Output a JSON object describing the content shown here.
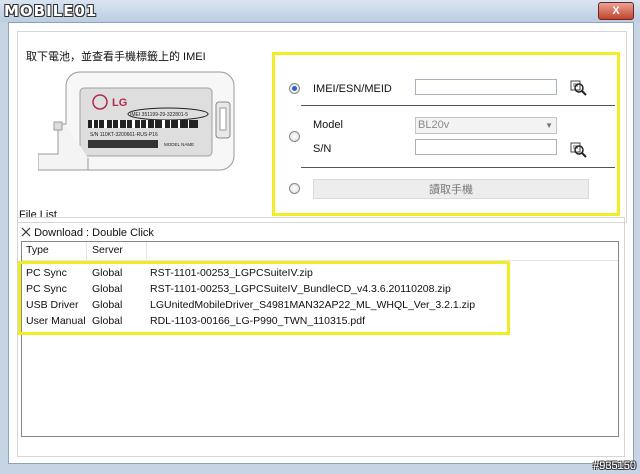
{
  "titlebar": {
    "logo": "MOBILE01",
    "close_label": "X"
  },
  "instructions": "取下電池，並查看手機標籤上的 IMEI",
  "device_label": {
    "brand": "LG",
    "imei_line": "IMEI 351199-29-322801-5",
    "sn_line": "S/N 110KT-3200661-RUS-P16",
    "model_line": "MODEL NAME"
  },
  "options": {
    "imei_label": "IMEI/ESN/MEID",
    "imei_value": "",
    "model_label": "Model",
    "model_value": "BL20v",
    "sn_label": "S/N",
    "sn_value": "",
    "read_phone_label": "讀取手機"
  },
  "file_list": {
    "label": "File List",
    "download_hint": "Download : Double Click",
    "columns": [
      "Type",
      "Server"
    ],
    "rows": [
      {
        "type": "PC Sync",
        "server": "Global",
        "file": "RST-1101-00253_LGPCSuiteIV.zip"
      },
      {
        "type": "PC Sync",
        "server": "Global",
        "file": "RST-1101-00253_LGPCSuiteIV_BundleCD_v4.3.6.20110208.zip"
      },
      {
        "type": "USB Driver",
        "server": "Global",
        "file": "LGUnitedMobileDriver_S4981MAN32AP22_ML_WHQL_Ver_3.2.1.zip"
      },
      {
        "type": "User Manual",
        "server": "Global",
        "file": "RDL-1103-00166_LG-P990_TWN_110315.pdf"
      }
    ]
  },
  "watermark": "#935150",
  "colors": {
    "highlight": "#f2ec26",
    "radio_selected": "#2b66c7"
  }
}
